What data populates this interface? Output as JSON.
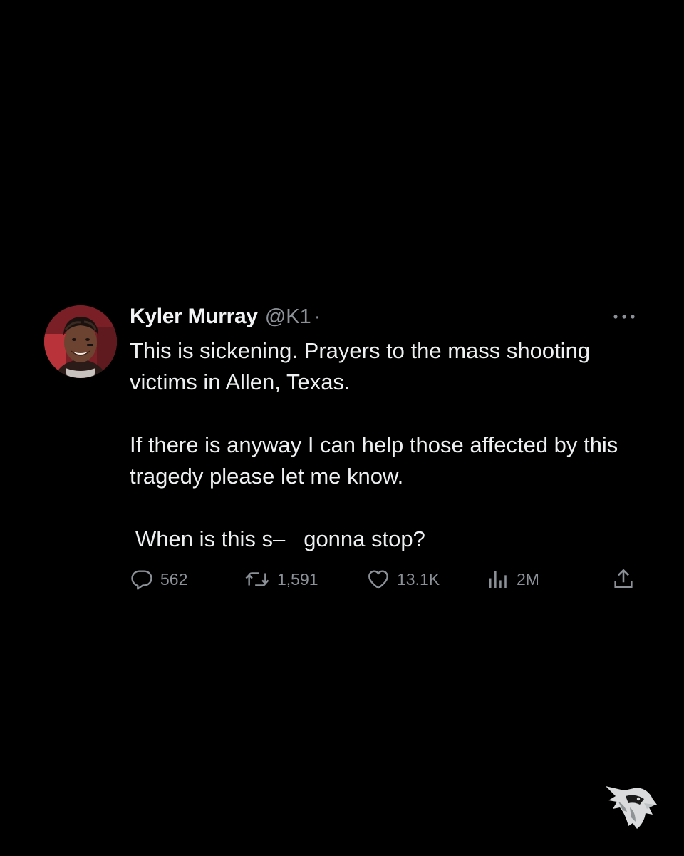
{
  "tweet": {
    "display_name": "Kyler Murray",
    "handle": "@K1",
    "separator": "·",
    "paragraphs": [
      "This is sickening. Prayers to the mass shooting victims in Allen, Texas.",
      "If there is anyway I can help those affected by this tragedy please let me know."
    ],
    "last_line": {
      "before": "When is this s–",
      "after": "gonna stop?"
    },
    "stats": {
      "replies": "562",
      "reposts": "1,591",
      "likes": "13.1K",
      "views": "2M"
    }
  },
  "icons": {
    "avatar": "avatar-photo",
    "more": "more-dots-icon",
    "reply": "reply-icon",
    "repost": "repost-icon",
    "like": "heart-icon",
    "views": "views-bar-chart-icon",
    "share": "share-upload-icon",
    "brand": "arizona-cardinals-logo"
  },
  "colors": {
    "background": "#000000",
    "text_primary": "#e7e9ea",
    "text_secondary": "#8b9197",
    "avatar_bg": "#7a1f25"
  }
}
